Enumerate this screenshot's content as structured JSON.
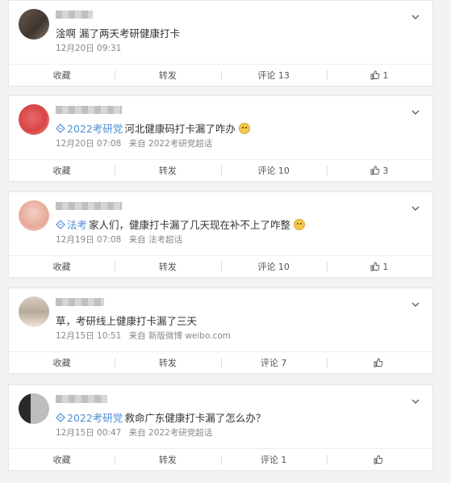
{
  "posts": [
    {
      "text": "淦啊 漏了两天考研健康打卡",
      "topic": "",
      "emoji": false,
      "time": "12月20日 09:31",
      "source": "",
      "actions": {
        "collect": "收藏",
        "repost": "转发",
        "comment": "评论 13",
        "like": "1"
      }
    },
    {
      "text": "河北健康码打卡漏了咋办",
      "topic": "2022考研党",
      "emoji": true,
      "time": "12月20日 07:08",
      "source": "来自 2022考研党超话",
      "actions": {
        "collect": "收藏",
        "repost": "转发",
        "comment": "评论 10",
        "like": "3"
      }
    },
    {
      "text": "家人们，健康打卡漏了几天现在补不上了咋整",
      "topic": "法考",
      "emoji": true,
      "time": "12月19日 07:08",
      "source": "来自 法考超话",
      "actions": {
        "collect": "收藏",
        "repost": "转发",
        "comment": "评论 10",
        "like": "1"
      }
    },
    {
      "text": "草，考研线上健康打卡漏了三天",
      "topic": "",
      "emoji": false,
      "time": "12月15日 10:51",
      "source": "来自 新版微博 weibo.com",
      "actions": {
        "collect": "收藏",
        "repost": "转发",
        "comment": "评论 7",
        "like": ""
      }
    },
    {
      "text": "救命广东健康打卡漏了怎么办？",
      "topic": "2022考研党",
      "emoji": false,
      "time": "12月15日 00:47",
      "source": "来自 2022考研党超话",
      "actions": {
        "collect": "收藏",
        "repost": "转发",
        "comment": "评论 1",
        "like": ""
      }
    }
  ]
}
